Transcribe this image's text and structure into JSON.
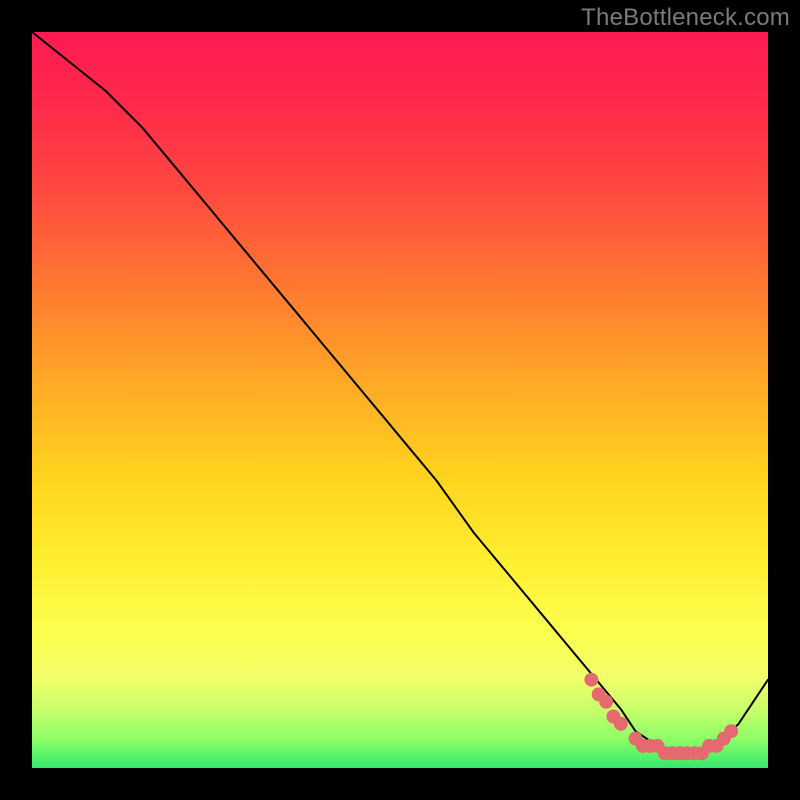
{
  "watermark": "TheBottleneck.com",
  "colors": {
    "dot": "#e46a6f",
    "curve": "#000000",
    "gradient_top": "#ff1a52",
    "gradient_mid": "#ffef30",
    "gradient_bottom": "#35e86e"
  },
  "chart_data": {
    "type": "line",
    "title": "",
    "xlabel": "",
    "ylabel": "",
    "xlim": [
      0,
      100
    ],
    "ylim": [
      0,
      100
    ],
    "series": [
      {
        "name": "curve",
        "x": [
          0,
          5,
          10,
          15,
          20,
          25,
          30,
          35,
          40,
          45,
          50,
          55,
          60,
          65,
          70,
          75,
          80,
          82,
          85,
          88,
          90,
          93,
          96,
          100
        ],
        "y": [
          100,
          96,
          92,
          87,
          81,
          75,
          69,
          63,
          57,
          51,
          45,
          39,
          32,
          26,
          20,
          14,
          8,
          5,
          3,
          2,
          2,
          3,
          6,
          12
        ]
      },
      {
        "name": "highlight-dots",
        "x": [
          76,
          77,
          78,
          79,
          80,
          82,
          83,
          84,
          85,
          86,
          87,
          88,
          89,
          90,
          91,
          92,
          93,
          94,
          95
        ],
        "y": [
          12,
          10,
          9,
          7,
          6,
          4,
          3,
          3,
          3,
          2,
          2,
          2,
          2,
          2,
          2,
          3,
          3,
          4,
          5
        ]
      }
    ],
    "annotations": []
  }
}
